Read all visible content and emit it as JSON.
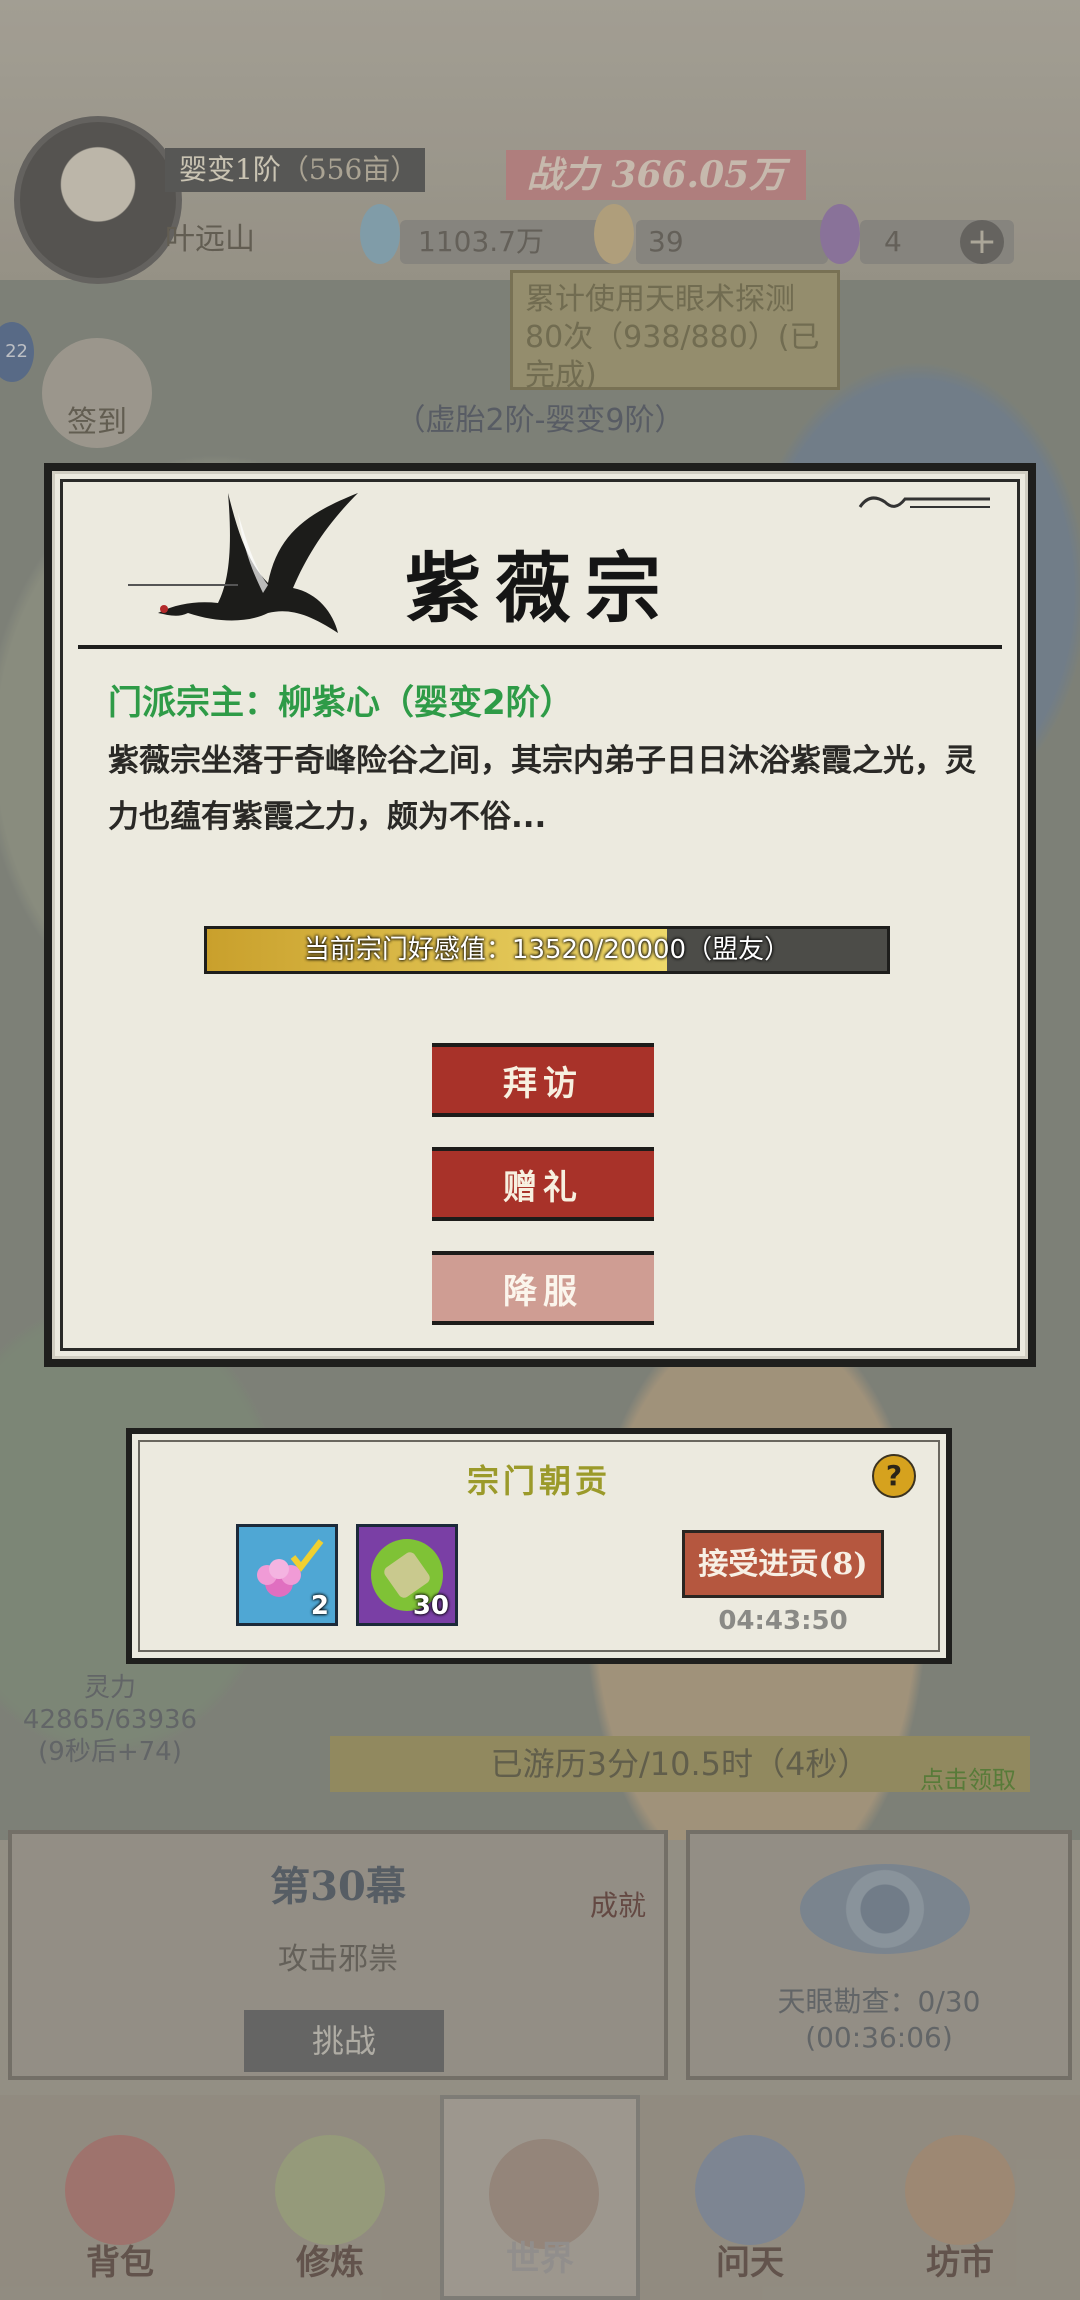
{
  "player": {
    "realm": "婴变1阶",
    "realm_extra": "（556亩）",
    "name": "叶远山",
    "power_label": "战力",
    "power_value": "366.05万",
    "resources": [
      {
        "name": "灵晶",
        "value": "1103.7万"
      },
      {
        "name": "化石",
        "value": "39"
      },
      {
        "name": "紫晶",
        "value": "4"
      }
    ]
  },
  "quest_tip": "累计使用天眼术探测80次（938/880）(已完成)",
  "realm_range": "（虚胎2阶-婴变9阶）",
  "sign_in_label": "签到",
  "left_badge": "22",
  "sect_dialog": {
    "title": "紫薇宗",
    "leader": "门派宗主：柳紫心（婴变2阶）",
    "description": "紫薇宗坐落于奇峰险谷之间，其宗内弟子日日沐浴紫霞之光，灵力也蕴有紫霞之力，颇为不俗...",
    "favor_label": "当前宗门好感值：13520/20000（盟友）",
    "favor_current": 13520,
    "favor_max": 20000,
    "buttons": {
      "visit": "拜访",
      "gift": "赠礼",
      "subdue": "降服"
    }
  },
  "tribute": {
    "title": "宗门朝贡",
    "help": "?",
    "items": [
      {
        "icon": "flower-icon",
        "count": "2"
      },
      {
        "icon": "bamboo-scroll-icon",
        "count": "30"
      }
    ],
    "accept_label": "接受进贡(8)",
    "timer": "04:43:50"
  },
  "lingli": {
    "label": "灵力",
    "value": "42865/63936",
    "rate": "(9秒后+74)"
  },
  "travel": {
    "label": "已游历3分/10.5时（4秒）",
    "claim": "点击领取"
  },
  "stage": {
    "title": "第30幕",
    "subtitle": "攻击邪祟",
    "challenge": "挑战",
    "achievement": "成就"
  },
  "sky_eye": {
    "label": "天眼勘查：0/30",
    "timer": "(00:36:06)"
  },
  "nav": [
    "背包",
    "修炼",
    "世界",
    "问天",
    "坊市"
  ],
  "colors": {
    "accent_red": "#a83229",
    "leader_green": "#2e9b47",
    "favor_gold": "#e0c04a",
    "tribute_title": "#9b9a2a"
  }
}
